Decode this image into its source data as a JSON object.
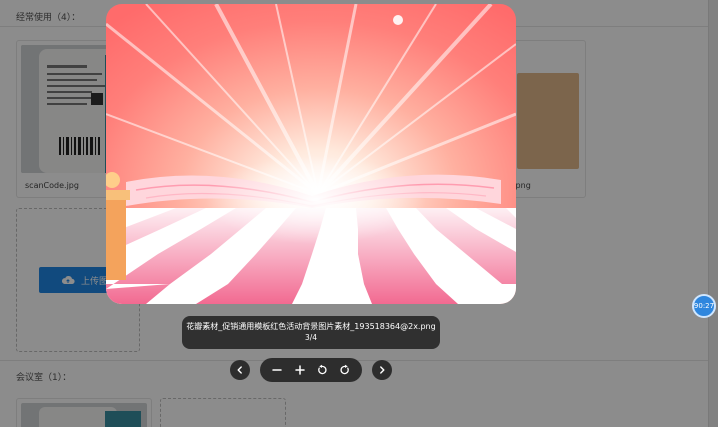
{
  "page": {
    "section_common_title": "经常使用（4）：",
    "section_meeting_title": "会议室（1）：",
    "cards": [
      {
        "caption": "scanCode.jpg"
      },
      {
        "caption": ".png"
      }
    ],
    "upload_button_label": "上传图片"
  },
  "viewer": {
    "filename": "花瓣素材_促销通用模板红色活动背景图片素材_193518364@2x.png",
    "index_text": "3/4",
    "icons": {
      "prev": "chevron-left-icon",
      "next": "chevron-right-icon",
      "zoom_out": "minus-icon",
      "zoom_in": "plus-icon",
      "rotate_left": "rotate-left-icon",
      "rotate_right": "rotate-right-icon"
    }
  },
  "float_badge": {
    "text": "90:27"
  },
  "colors": {
    "accent": "#1f87e6",
    "toolbar_bg": "#2d2d2d",
    "mask": "rgba(0,0,0,0.45)"
  }
}
